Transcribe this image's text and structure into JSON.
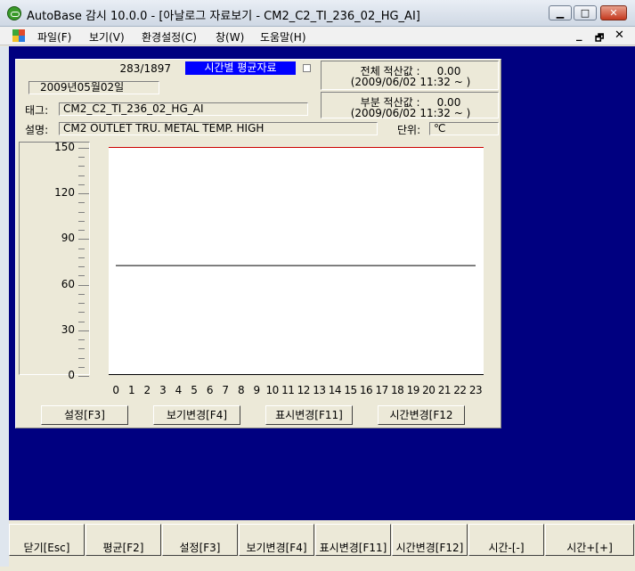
{
  "window": {
    "title": "AutoBase 감시 10.0.0 - [아날로그 자료보기 - CM2_C2_TI_236_02_HG_AI]",
    "min_glyph": "▁",
    "max_glyph": "□",
    "close_glyph": "✕"
  },
  "menu": {
    "items": [
      "파일(F)",
      "보기(V)",
      "환경설정(C)",
      "창(W)",
      "도움말(H)"
    ],
    "mdi_min": "_",
    "mdi_restore": "🗗",
    "mdi_close": "✕"
  },
  "panel": {
    "record_count": "283/1897",
    "mode_label": "시간별 평균자료",
    "date": "2009년05월02일",
    "total": {
      "label": "전체 적산값 :",
      "value": "0.00",
      "since": "(2009/06/02 11:32 ~ )"
    },
    "partial": {
      "label": "부분 적산값 :",
      "value": "0.00",
      "since": "(2009/06/02 11:32 ~ )"
    },
    "tag_label": "태그:",
    "tag_value": "CM2_C2_TI_236_02_HG_AI",
    "desc_label": "설명:",
    "desc_value": "CM2 OUTLET TRU. METAL TEMP. HIGH",
    "unit_label": "단위:",
    "unit_value": "℃",
    "buttons": {
      "settings": "설정[F3]",
      "view_change": "보기변경[F4]",
      "display_change": "표시변경[F11]",
      "time_change": "시간변경[F12"
    }
  },
  "chart_data": {
    "type": "line",
    "y_ticks": [
      "150",
      "120",
      "90",
      "60",
      "30",
      "0"
    ],
    "x_ticks": [
      "0",
      "1",
      "2",
      "3",
      "4",
      "5",
      "6",
      "7",
      "8",
      "9",
      "10",
      "11",
      "12",
      "13",
      "14",
      "15",
      "16",
      "17",
      "18",
      "19",
      "20",
      "21",
      "22",
      "23"
    ],
    "ylim": [
      0,
      150
    ],
    "xlim": [
      0,
      23
    ],
    "high_limit": 150,
    "series": [
      {
        "values": [
          72,
          72,
          72,
          72,
          72,
          72,
          72,
          72,
          72,
          72,
          72,
          72,
          72,
          72,
          72,
          72,
          72,
          72,
          72,
          72,
          72,
          72,
          72,
          72
        ]
      }
    ],
    "colors": {
      "series": "#000000",
      "high_limit": "#cc0000"
    }
  },
  "footer": {
    "buttons": [
      "닫기[Esc]",
      "평균[F2]",
      "설정[F3]",
      "보기변경[F4]",
      "표시변경[F11]",
      "시간변경[F12]",
      "시간-[-]",
      "시간+[+]"
    ]
  }
}
